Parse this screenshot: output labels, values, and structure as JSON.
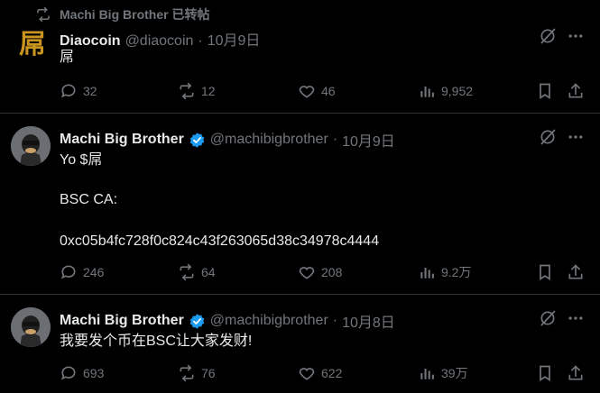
{
  "repost_header": {
    "label": "Machi Big Brother 已转帖"
  },
  "tweets": [
    {
      "author": "Diaocoin",
      "handle": "@diaocoin",
      "dot": "·",
      "date": "10月9日",
      "lines": [
        "屌"
      ],
      "avatar_char": "屌",
      "verified": false,
      "stats": {
        "replies": "32",
        "reposts": "12",
        "likes": "46",
        "views": "9,952"
      }
    },
    {
      "author": "Machi Big Brother",
      "handle": "@machibigbrother",
      "dot": "·",
      "date": "10月9日",
      "lines": [
        "Yo $屌",
        "BSC CA:",
        "0xc05b4fc728f0c824c43f263065d38c34978c4444"
      ],
      "verified": true,
      "stats": {
        "replies": "246",
        "reposts": "64",
        "likes": "208",
        "views": "9.2万"
      }
    },
    {
      "author": "Machi Big Brother",
      "handle": "@machibigbrother",
      "dot": "·",
      "date": "10月8日",
      "lines": [
        "我要发个币在BSC让大家发财!"
      ],
      "verified": true,
      "stats": {
        "replies": "693",
        "reposts": "76",
        "likes": "622",
        "views": "39万"
      }
    }
  ],
  "colors": {
    "background": "#000000",
    "text": "#e7e9ea",
    "muted": "#71767b",
    "verified": "#1d9bf0",
    "divider": "#2f3336"
  }
}
